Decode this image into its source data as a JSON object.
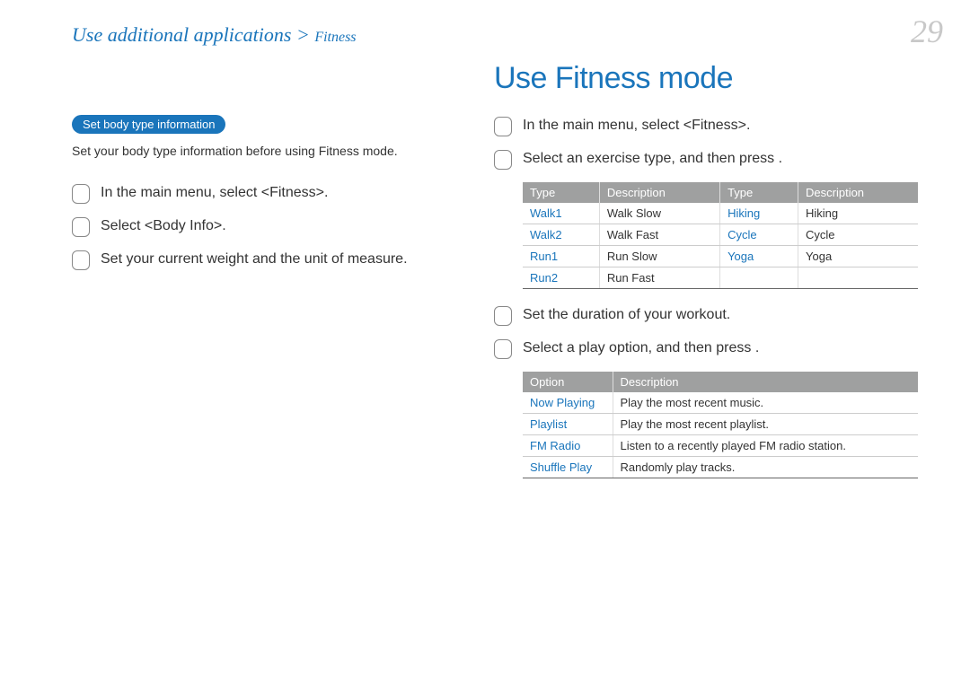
{
  "breadcrumb": {
    "main": "Use additional applications",
    "sep": ">",
    "sub": "Fitness"
  },
  "page_number": "29",
  "left": {
    "pill": "Set body type information",
    "paragraph": "Set your body type information before using Fitness mode.",
    "steps": [
      "In the main menu, select <Fitness>.",
      "Select <Body Info>.",
      "Set your current weight and the unit of measure."
    ]
  },
  "right": {
    "title": "Use Fitness mode",
    "steps_top": [
      "In the main menu, select <Fitness>.",
      "Select an exercise type, and then press       ."
    ],
    "exercise_table": {
      "headers": [
        "Type",
        "Description",
        "Type",
        "Description"
      ],
      "rows": [
        [
          "Walk1",
          "Walk Slow",
          "Hiking",
          "Hiking"
        ],
        [
          "Walk2",
          "Walk Fast",
          "Cycle",
          "Cycle"
        ],
        [
          "Run1",
          "Run Slow",
          "Yoga",
          "Yoga"
        ],
        [
          "Run2",
          "Run Fast",
          "",
          ""
        ]
      ]
    },
    "steps_mid": [
      "Set the duration of your workout.",
      "Select a play option, and then press       ."
    ],
    "options_table": {
      "headers": [
        "Option",
        "Description"
      ],
      "rows": [
        [
          "Now Playing",
          "Play the most recent music."
        ],
        [
          "Playlist",
          "Play the most recent playlist."
        ],
        [
          "FM Radio",
          "Listen to a recently played FM radio station."
        ],
        [
          "Shuffle Play",
          "Randomly play tracks."
        ]
      ]
    }
  }
}
